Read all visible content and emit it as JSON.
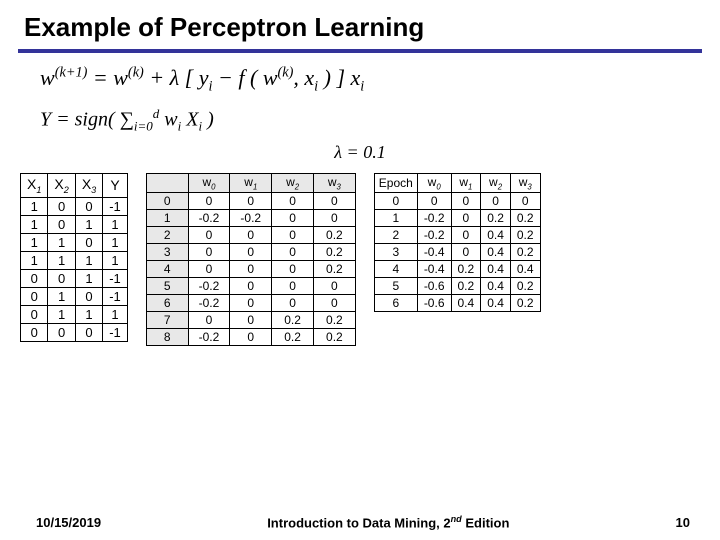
{
  "title": "Example of Perceptron Learning",
  "eq1_html": "<i>w</i><sup>(<i>k</i>+1)</sup> = <i>w</i><sup>(<i>k</i>)</sup> + λ [ <i>y</i><sub>i</sub> − <i>f</i> ( <i>w</i><sup>(<i>k</i>)</sup>, <i>x</i><sub>i</sub> ) ] <i>x</i><sub>i</sub>",
  "eq2_html": "<i>Y</i> = <i>sign</i>( ∑<sub>i=0</sub><sup>d</sup> <i>w</i><sub>i</sub> <i>X</i><sub>i</sub> )",
  "lambda_eq": "λ = 0.1",
  "table_xy": {
    "headers": [
      "X<sub>1</sub>",
      "X<sub>2</sub>",
      "X<sub>3</sub>",
      "Y"
    ],
    "rows": [
      [
        "1",
        "0",
        "0",
        "-1"
      ],
      [
        "1",
        "0",
        "1",
        "1"
      ],
      [
        "1",
        "1",
        "0",
        "1"
      ],
      [
        "1",
        "1",
        "1",
        "1"
      ],
      [
        "0",
        "0",
        "1",
        "-1"
      ],
      [
        "0",
        "1",
        "0",
        "-1"
      ],
      [
        "0",
        "1",
        "1",
        "1"
      ],
      [
        "0",
        "0",
        "0",
        "-1"
      ]
    ]
  },
  "table_iter": {
    "headers": [
      "",
      "w<sub>0</sub>",
      "w<sub>1</sub>",
      "w<sub>2</sub>",
      "w<sub>3</sub>"
    ],
    "rows": [
      [
        "0",
        "0",
        "0",
        "0",
        "0"
      ],
      [
        "1",
        "-0.2",
        "-0.2",
        "0",
        "0"
      ],
      [
        "2",
        "0",
        "0",
        "0",
        "0.2"
      ],
      [
        "3",
        "0",
        "0",
        "0",
        "0.2"
      ],
      [
        "4",
        "0",
        "0",
        "0",
        "0.2"
      ],
      [
        "5",
        "-0.2",
        "0",
        "0",
        "0"
      ],
      [
        "6",
        "-0.2",
        "0",
        "0",
        "0"
      ],
      [
        "7",
        "0",
        "0",
        "0.2",
        "0.2"
      ],
      [
        "8",
        "-0.2",
        "0",
        "0.2",
        "0.2"
      ]
    ]
  },
  "table_epoch": {
    "headers": [
      "Epoch",
      "w<sub>0</sub>",
      "w<sub>1</sub>",
      "w<sub>2</sub>",
      "w<sub>3</sub>"
    ],
    "rows": [
      [
        "0",
        "0",
        "0",
        "0",
        "0"
      ],
      [
        "1",
        "-0.2",
        "0",
        "0.2",
        "0.2"
      ],
      [
        "2",
        "-0.2",
        "0",
        "0.4",
        "0.2"
      ],
      [
        "3",
        "-0.4",
        "0",
        "0.4",
        "0.2"
      ],
      [
        "4",
        "-0.4",
        "0.2",
        "0.4",
        "0.4"
      ],
      [
        "5",
        "-0.6",
        "0.2",
        "0.4",
        "0.2"
      ],
      [
        "6",
        "-0.6",
        "0.4",
        "0.4",
        "0.2"
      ]
    ]
  },
  "footer": {
    "date": "10/15/2019",
    "title_html": "Introduction to Data Mining, 2<sup>nd</sup> Edition",
    "page": "10"
  }
}
